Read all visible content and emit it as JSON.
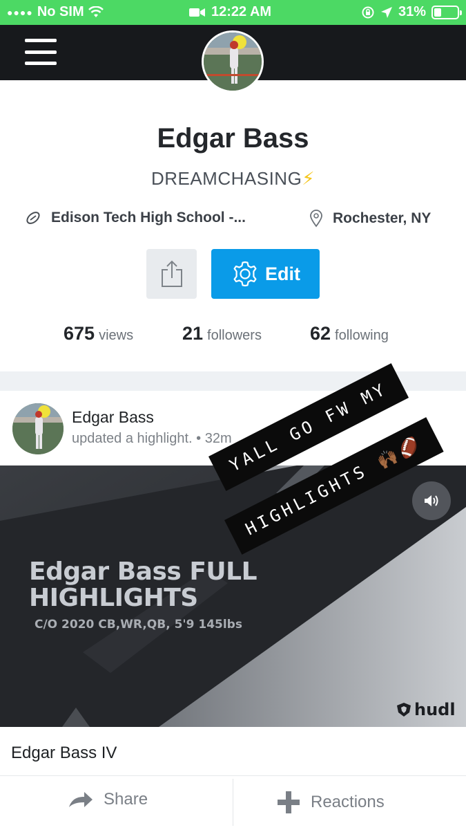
{
  "status_bar": {
    "carrier": "No SIM",
    "time": "12:22 AM",
    "battery": "31%",
    "battery_level": 0.31,
    "background": "#4cd964"
  },
  "profile": {
    "name": "Edgar Bass",
    "bio": "DREAMCHASING",
    "bio_emoji": "⚡",
    "school": "Edison Tech High School -...",
    "location": "Rochester, NY",
    "edit_label": "Edit",
    "stats": [
      {
        "value": "675",
        "label": "views"
      },
      {
        "value": "21",
        "label": "followers"
      },
      {
        "value": "62",
        "label": "following"
      }
    ]
  },
  "post": {
    "author": "Edgar Bass",
    "action": "updated a highlight. • 32m",
    "video": {
      "title_line1": "Edgar Bass FULL",
      "title_line2": "HIGHLIGHTS",
      "subtitle": "C/O 2020 CB,WR,QB, 5'9 145lbs",
      "brand": "hudl"
    },
    "stickers": [
      "YALL GO FW MY",
      "HIGHLIGHTS 🙌🏾🏈"
    ],
    "caption": "Edgar Bass IV",
    "share_label": "Share",
    "reactions_label": "Reactions"
  },
  "colors": {
    "accent": "#0a9be8",
    "appbar": "#17191c"
  },
  "icons": {
    "menu": "hamburger-icon",
    "school": "football-icon",
    "location": "map-pin-icon",
    "share": "share-upload-icon",
    "edit": "gear-icon",
    "mute": "speaker-icon",
    "share_action": "arrow-share-icon",
    "reactions": "plus-icon"
  }
}
